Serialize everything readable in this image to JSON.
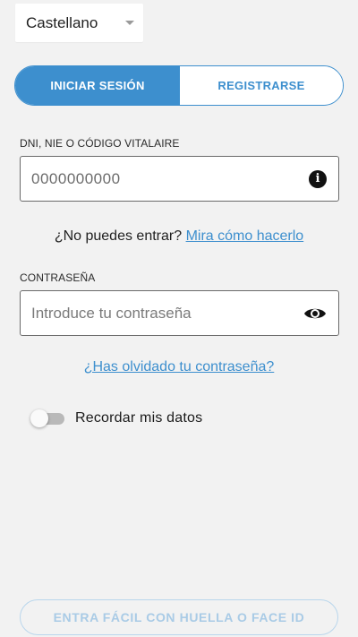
{
  "language": {
    "selected": "Castellano"
  },
  "tabs": [
    {
      "label": "INICIAR SESIÓN",
      "active": true
    },
    {
      "label": "REGISTRARSE",
      "active": false
    }
  ],
  "id_field": {
    "label": "DNI, NIE O CÓDIGO VITALAIRE",
    "value": "0000000000",
    "icon": "info-icon"
  },
  "help": {
    "text": "¿No puedes entrar?",
    "link": "Mira cómo hacerlo"
  },
  "password_field": {
    "label": "CONTRASEÑA",
    "placeholder": "Introduce tu contraseña",
    "icon": "eye-icon"
  },
  "forgot_link": "¿Has olvidado tu contraseña?",
  "remember": {
    "label": "Recordar mis datos",
    "enabled": false
  },
  "biometric_button": "ENTRA FÁCIL CON HUELLA O FACE ID",
  "colors": {
    "accent": "#3d8fce",
    "background": "#f2f2f2",
    "disabled": "#a9cbe6"
  }
}
